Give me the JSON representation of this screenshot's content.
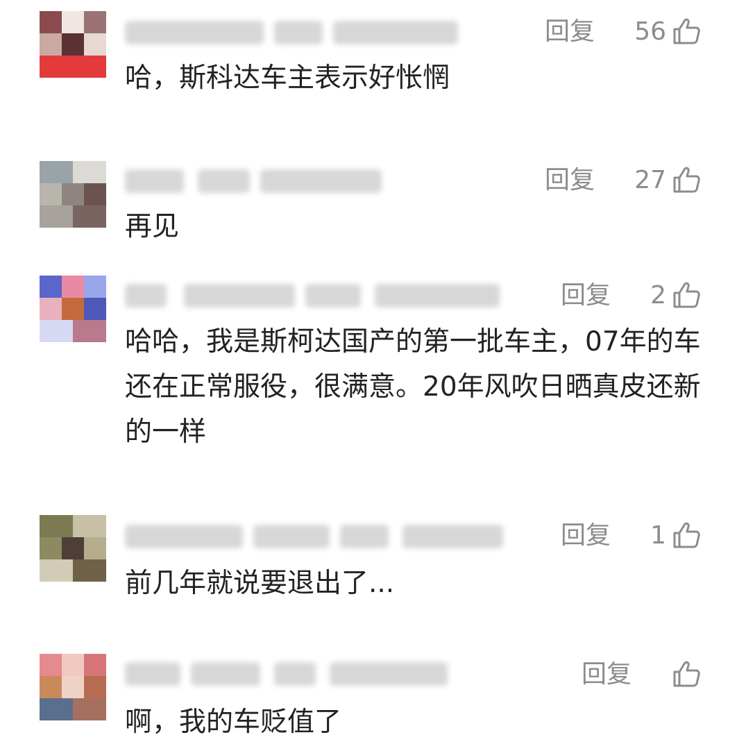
{
  "comments": [
    {
      "reply_label": "回复",
      "likes": "56",
      "text": "哈，斯科达车主表示好怅惘",
      "avatar_colors": [
        "#8a4a4e",
        "#d9c3bd",
        "#e33b3b",
        "#5a3235"
      ]
    },
    {
      "reply_label": "回复",
      "likes": "27",
      "text": "再见",
      "avatar_colors": [
        "#9aa3a8",
        "#c9c6c0",
        "#6b5350",
        "#b8b5ad"
      ]
    },
    {
      "reply_label": "回复",
      "likes": "2",
      "text": "哈哈，我是斯柯达国产的第一批车主，07年的车还在正常服役，很满意。20年风吹日晒真皮还新的一样",
      "avatar_colors": [
        "#5a66c9",
        "#e88aa6",
        "#c56a3d",
        "#7b8de0"
      ]
    },
    {
      "reply_label": "回复",
      "likes": "1",
      "text": "前几年就说要退出了...",
      "avatar_colors": [
        "#7c7a52",
        "#a6a37a",
        "#4f3e37",
        "#c7c0a7"
      ]
    },
    {
      "reply_label": "回复",
      "likes": "",
      "text": "啊，我的车贬值了",
      "avatar_colors": [
        "#e58a8e",
        "#c98a5a",
        "#5a6e8d",
        "#e9b3a3"
      ]
    }
  ],
  "icons": {
    "like": "thumbs-up-icon"
  }
}
